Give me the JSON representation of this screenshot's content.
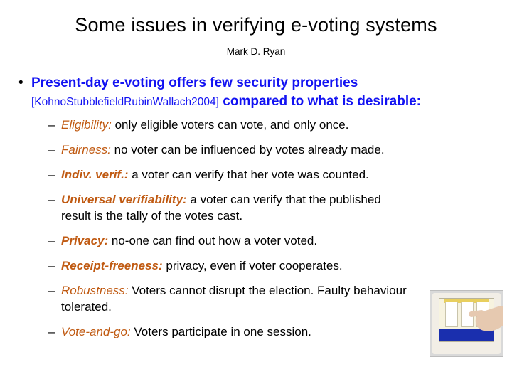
{
  "title": "Some issues in verifying e-voting systems",
  "author": "Mark D. Ryan",
  "main_point": {
    "lead": "Present-day e-voting offers few security properties",
    "citation": "[KohnoStubblefieldRubinWallach2004]",
    "trail": "compared to what is desirable:"
  },
  "properties": [
    {
      "term": "Eligibility:",
      "bold": false,
      "text": " only eligible voters can vote, and only once."
    },
    {
      "term": "Fairness:",
      "bold": false,
      "text": " no voter can be influenced by votes already made."
    },
    {
      "term": "Indiv. verif.:",
      "bold": true,
      "text": " a voter can verify that her vote was counted."
    },
    {
      "term": "Universal verifiability:",
      "bold": true,
      "text": " a voter can verify that the published result is the tally of the votes cast."
    },
    {
      "term": "Privacy:",
      "bold": true,
      "text": " no-one can find out how a voter voted."
    },
    {
      "term": "Receipt-freeness:",
      "bold": true,
      "text": " privacy, even if voter cooperates."
    },
    {
      "term": "Robustness:",
      "bold": false,
      "text": " Voters cannot disrupt the election. Faulty behaviour tolerated."
    },
    {
      "term": "Vote-and-go:",
      "bold": false,
      "text": " Voters participate in one session."
    }
  ],
  "image": {
    "alt": "voting-machine-photo"
  }
}
